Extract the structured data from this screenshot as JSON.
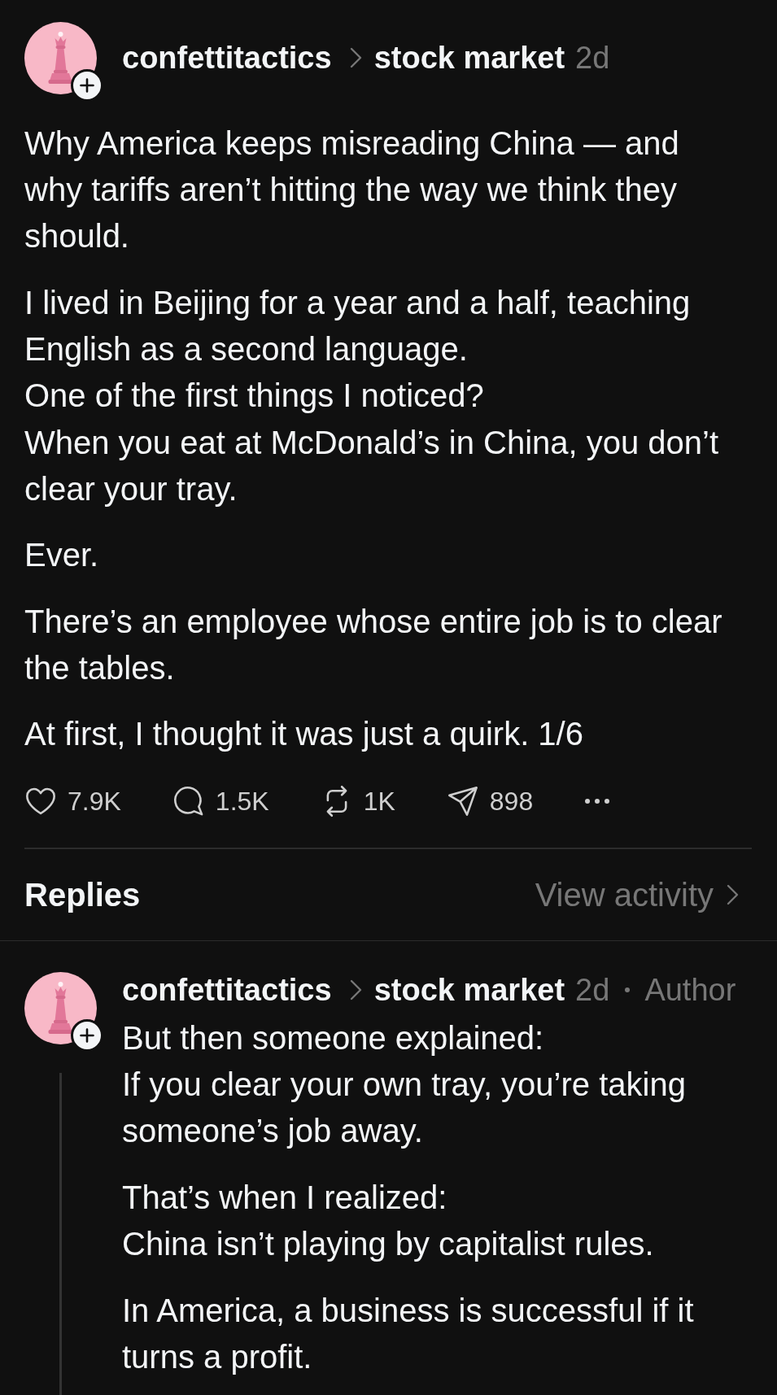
{
  "post": {
    "author": {
      "username": "confettitactics",
      "community": "stock market",
      "time": "2d"
    },
    "paragraphs": [
      "Why America keeps misreading China — and\nwhy tariffs aren’t hitting the way we think they\nshould.",
      "I lived in Beijing for a year and a half, teaching\nEnglish as a second language.\nOne of the first things I noticed?\nWhen you eat at McDonald’s in China, you don’t\nclear your tray.",
      "Ever.",
      "There’s an employee whose entire job is to clear\nthe tables.",
      "At first, I thought it was just a quirk. 1/6"
    ],
    "actions": [
      {
        "kind": "like",
        "count": "7.9K"
      },
      {
        "kind": "reply",
        "count": "1.5K"
      },
      {
        "kind": "repost",
        "count": "1K"
      },
      {
        "kind": "share",
        "count": "898"
      },
      {
        "kind": "more"
      }
    ]
  },
  "replies_bar": {
    "title": "Replies",
    "link": "View activity"
  },
  "replies": [
    {
      "author": {
        "username": "confettitactics",
        "community": "stock market",
        "time": "2d",
        "tag": "Author"
      },
      "paragraphs": [
        "But then someone explained:\nIf you clear your own tray, you’re taking\nsomeone’s job away.",
        "That’s when I realized:\nChina isn’t playing by capitalist rules.",
        "In America, a business is successful if it\nturns a profit."
      ]
    }
  ]
}
